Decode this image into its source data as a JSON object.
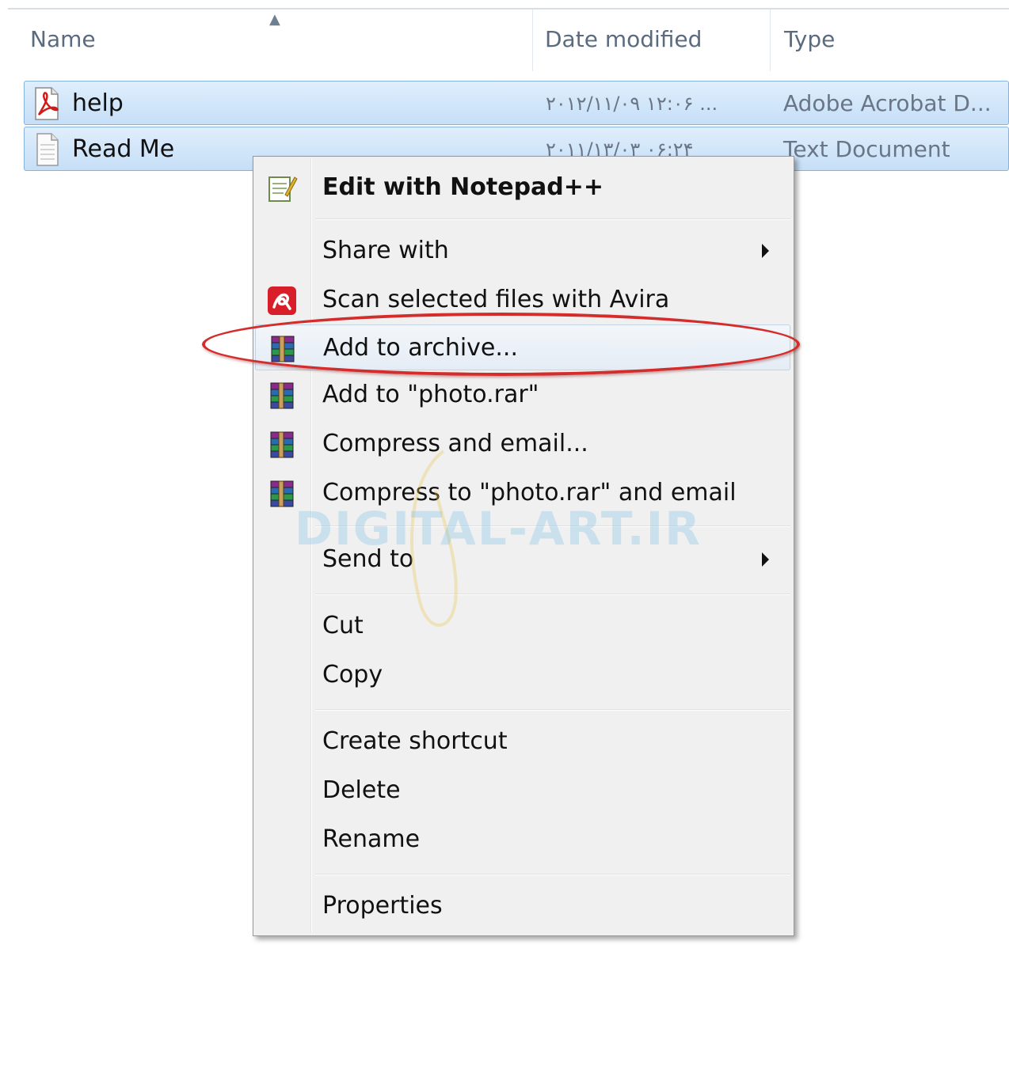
{
  "columns": {
    "name": "Name",
    "date_modified": "Date modified",
    "type": "Type"
  },
  "files": [
    {
      "name": "help",
      "date": "۲۰۱۲/۱۱/۰۹ ۱۲:۰۶ ...",
      "type": "Adobe Acrobat D...",
      "icon": "pdf-file-icon"
    },
    {
      "name": "Read Me",
      "date": "۲۰۱۱/۱۳/۰۳ ۰۶:۲۴",
      "type": "Text Document",
      "icon": "text-file-icon"
    }
  ],
  "context_menu": {
    "edit_notepad": "Edit with Notepad++",
    "share_with": "Share with",
    "scan_avira": "Scan selected files with Avira",
    "add_to_archive": "Add to archive...",
    "add_to_photo_rar": "Add to \"photo.rar\"",
    "compress_email": "Compress and email...",
    "compress_photo_email": "Compress to \"photo.rar\" and email",
    "send_to": "Send to",
    "cut": "Cut",
    "copy": "Copy",
    "create_shortcut": "Create shortcut",
    "delete": "Delete",
    "rename": "Rename",
    "properties": "Properties"
  },
  "watermark": "DIGITAL-ART.IR",
  "colors": {
    "selection": "#c6dff7",
    "highlight_ring": "#d42b2b",
    "menu_bg": "#f0f0f0"
  }
}
